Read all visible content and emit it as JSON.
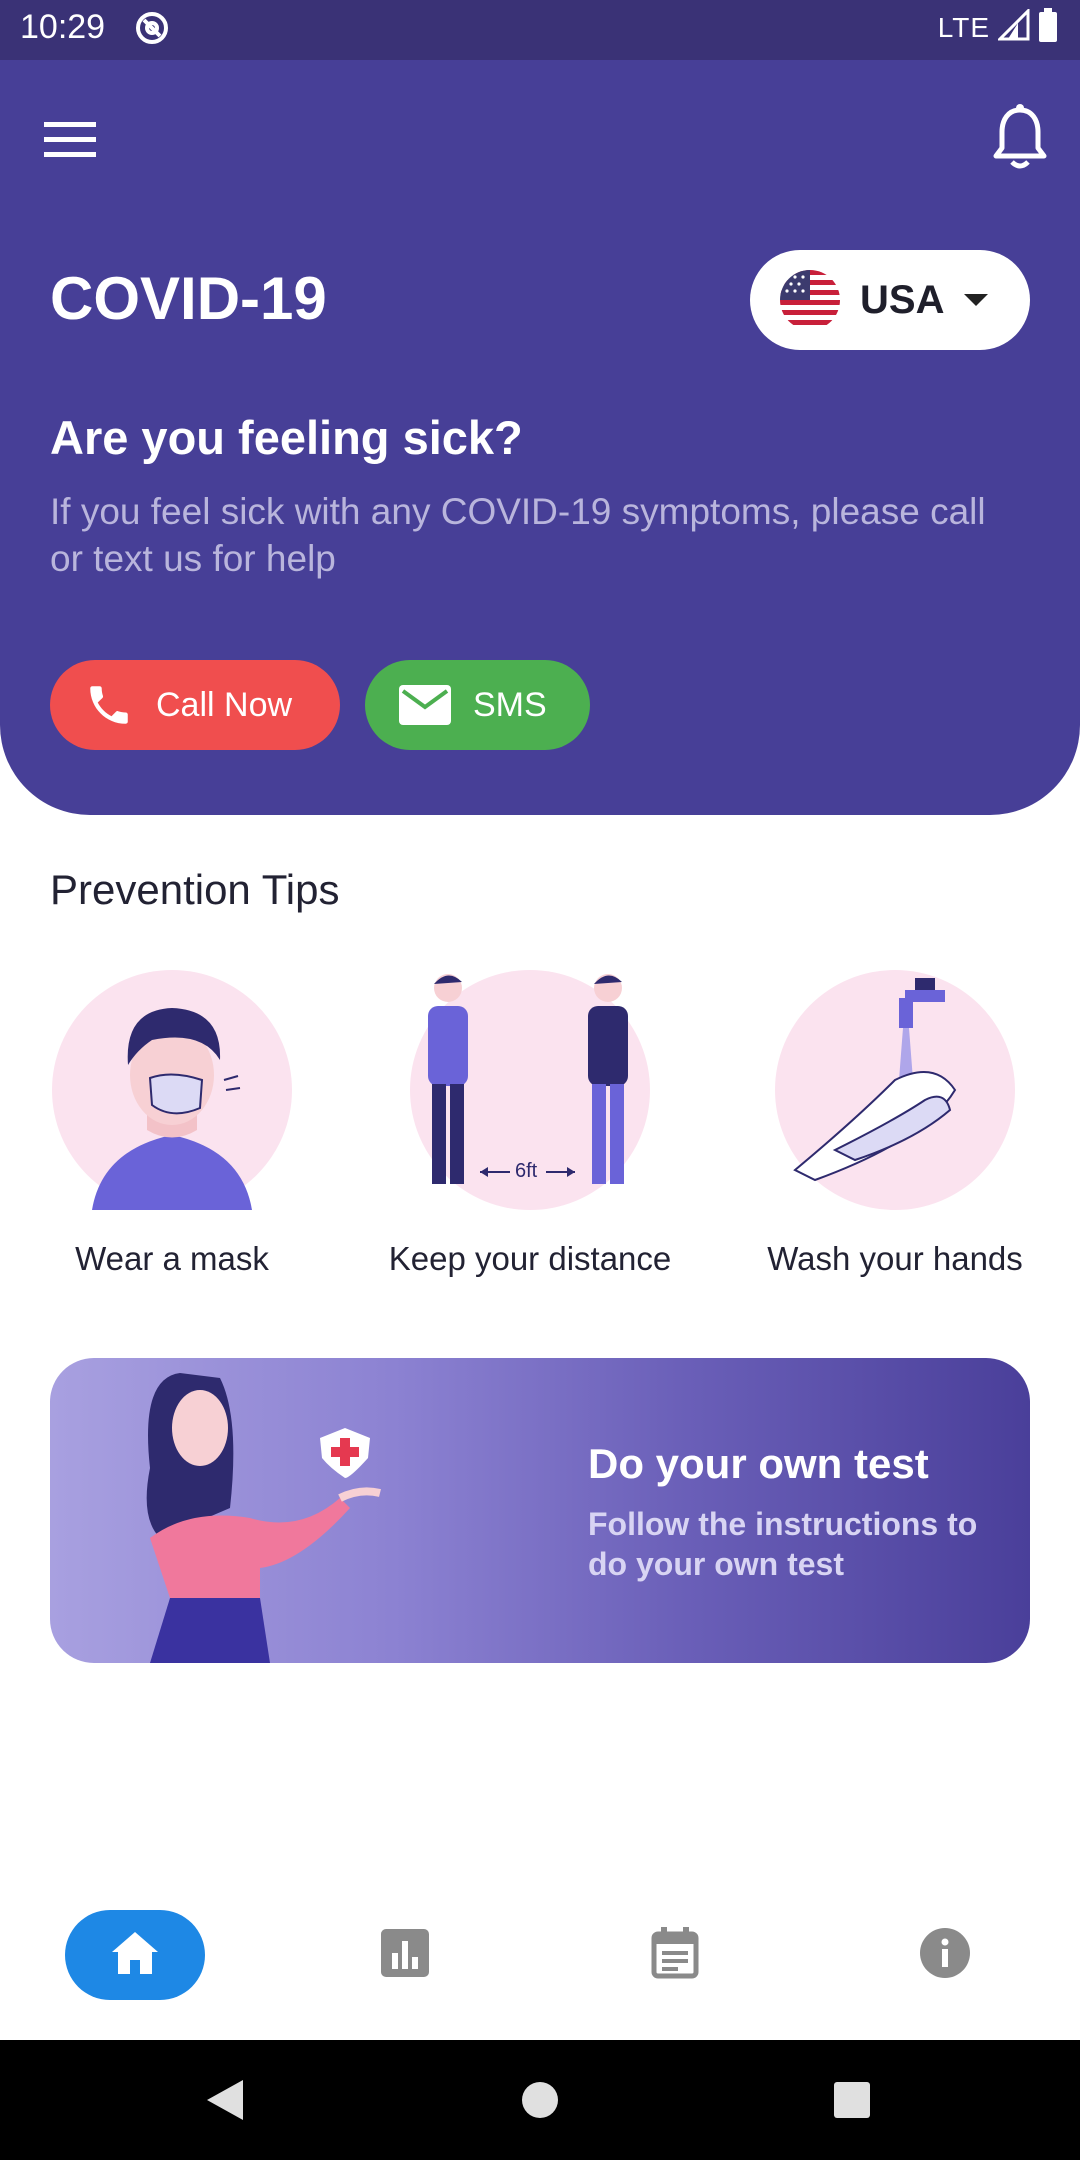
{
  "status_bar": {
    "time": "10:29",
    "network": "LTE"
  },
  "header": {
    "app_title": "COVID-19",
    "country": "USA",
    "sick_title": "Are you feeling sick?",
    "sick_description": "If you feel sick with any COVID-19 symptoms, please call or text us for help",
    "call_label": "Call Now",
    "sms_label": "SMS"
  },
  "prevention": {
    "title": "Prevention Tips",
    "tips": [
      {
        "label": "Wear a mask"
      },
      {
        "label": "Keep your distance",
        "distance_text": "6ft"
      },
      {
        "label": "Wash your hands"
      }
    ]
  },
  "test_banner": {
    "title": "Do your own test",
    "description": "Follow the instructions to do your own test"
  },
  "colors": {
    "primary": "#473f97",
    "call": "#f04e4e",
    "sms": "#4caf50",
    "active_nav": "#1e88e5"
  },
  "bottom_nav": {
    "items": [
      {
        "icon": "home-icon",
        "active": true
      },
      {
        "icon": "stats-icon",
        "active": false
      },
      {
        "icon": "calendar-icon",
        "active": false
      },
      {
        "icon": "info-icon",
        "active": false
      }
    ]
  }
}
